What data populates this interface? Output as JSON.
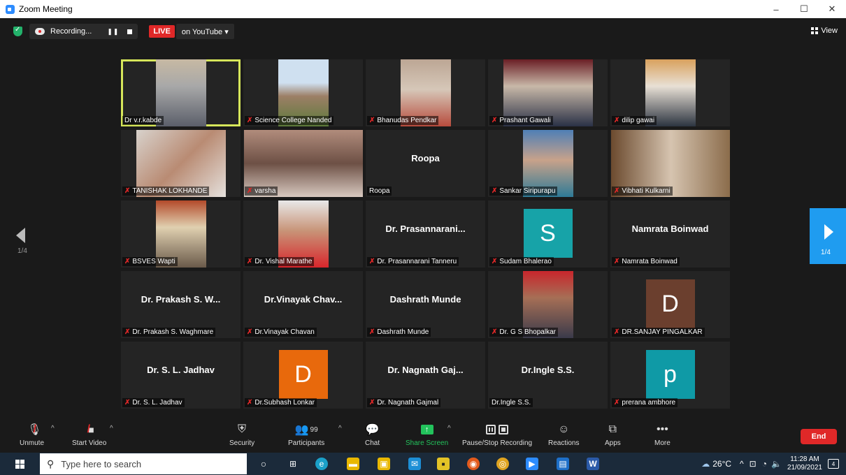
{
  "window": {
    "title": "Zoom Meeting",
    "controls": [
      "–",
      "☐",
      "✕"
    ]
  },
  "topbar": {
    "recording_text": "Recording...",
    "pause_symbol": "❚❚",
    "live_label": "LIVE",
    "stream_label": "on YouTube ▾",
    "view_label": "View"
  },
  "participants": [
    {
      "label": "Dr v.r.kabde",
      "muted": false,
      "kind": "photo",
      "active": true
    },
    {
      "label": "Science College Nanded",
      "muted": true,
      "kind": "photo"
    },
    {
      "label": "Bhanudas Pendkar",
      "muted": true,
      "kind": "photo"
    },
    {
      "label": "Prashant Gawali",
      "muted": true,
      "kind": "photo"
    },
    {
      "label": "dilip gawai",
      "muted": true,
      "kind": "photo"
    },
    {
      "label": "TANISHAK LOKHANDE",
      "muted": true,
      "kind": "photo"
    },
    {
      "label": "varsha",
      "muted": true,
      "kind": "photo"
    },
    {
      "label": "Roopa",
      "muted": false,
      "kind": "name",
      "display": "Roopa"
    },
    {
      "label": "Sankar Siripurapu",
      "muted": true,
      "kind": "photo"
    },
    {
      "label": "Vibhati Kulkarni",
      "muted": true,
      "kind": "photo"
    },
    {
      "label": "BSVES Wapti",
      "muted": true,
      "kind": "photo"
    },
    {
      "label": "Dr. Vishal Marathe",
      "muted": true,
      "kind": "photo"
    },
    {
      "label": "Dr. Prasannarani Tanneru",
      "muted": true,
      "kind": "name",
      "display": "Dr. Prasannarani..."
    },
    {
      "label": "Sudam Bhalerao",
      "muted": true,
      "kind": "avatar",
      "letter": "S",
      "color": "#17a3a8"
    },
    {
      "label": "Namrata Boinwad",
      "muted": true,
      "kind": "name",
      "display": "Namrata Boinwad"
    },
    {
      "label": "Dr. Prakash S. Waghmare",
      "muted": true,
      "kind": "name",
      "display": "Dr. Prakash S. W..."
    },
    {
      "label": "Dr.Vinayak Chavan",
      "muted": true,
      "kind": "name",
      "display": "Dr.Vinayak Chav..."
    },
    {
      "label": "Dashrath Munde",
      "muted": true,
      "kind": "name",
      "display": "Dashrath Munde"
    },
    {
      "label": "Dr. G S Bhopalkar",
      "muted": true,
      "kind": "photo"
    },
    {
      "label": "DR.SANJAY PINGALKAR",
      "muted": true,
      "kind": "avatar",
      "letter": "D",
      "color": "#6b3f2e"
    },
    {
      "label": "Dr. S. L. Jadhav",
      "muted": true,
      "kind": "name",
      "display": "Dr. S. L. Jadhav"
    },
    {
      "label": "Dr.Subhash Lonkar",
      "muted": true,
      "kind": "avatar",
      "letter": "D",
      "color": "#e8690c"
    },
    {
      "label": "Dr. Nagnath Gajmal",
      "muted": true,
      "kind": "name",
      "display": "Dr. Nagnath Gaj..."
    },
    {
      "label": "Dr.Ingle S.S.",
      "muted": false,
      "kind": "name",
      "display": "Dr.Ingle S.S."
    },
    {
      "label": "prerana ambhore",
      "muted": true,
      "kind": "avatar",
      "letter": "p",
      "color": "#0f9aa6"
    }
  ],
  "pager": {
    "left": "1/4",
    "right": "1/4"
  },
  "toolbar": {
    "unmute": "Unmute",
    "start_video": "Start Video",
    "security": "Security",
    "participants": "Participants",
    "participants_count": "99",
    "chat": "Chat",
    "share_screen": "Share Screen",
    "pause_recording": "Pause/Stop Recording",
    "reactions": "Reactions",
    "apps": "Apps",
    "more": "More",
    "end": "End"
  },
  "taskbar": {
    "search_placeholder": "Type here to search",
    "weather": "26°C",
    "time": "11:28 AM",
    "date": "21/09/2021",
    "notifications": "4"
  }
}
